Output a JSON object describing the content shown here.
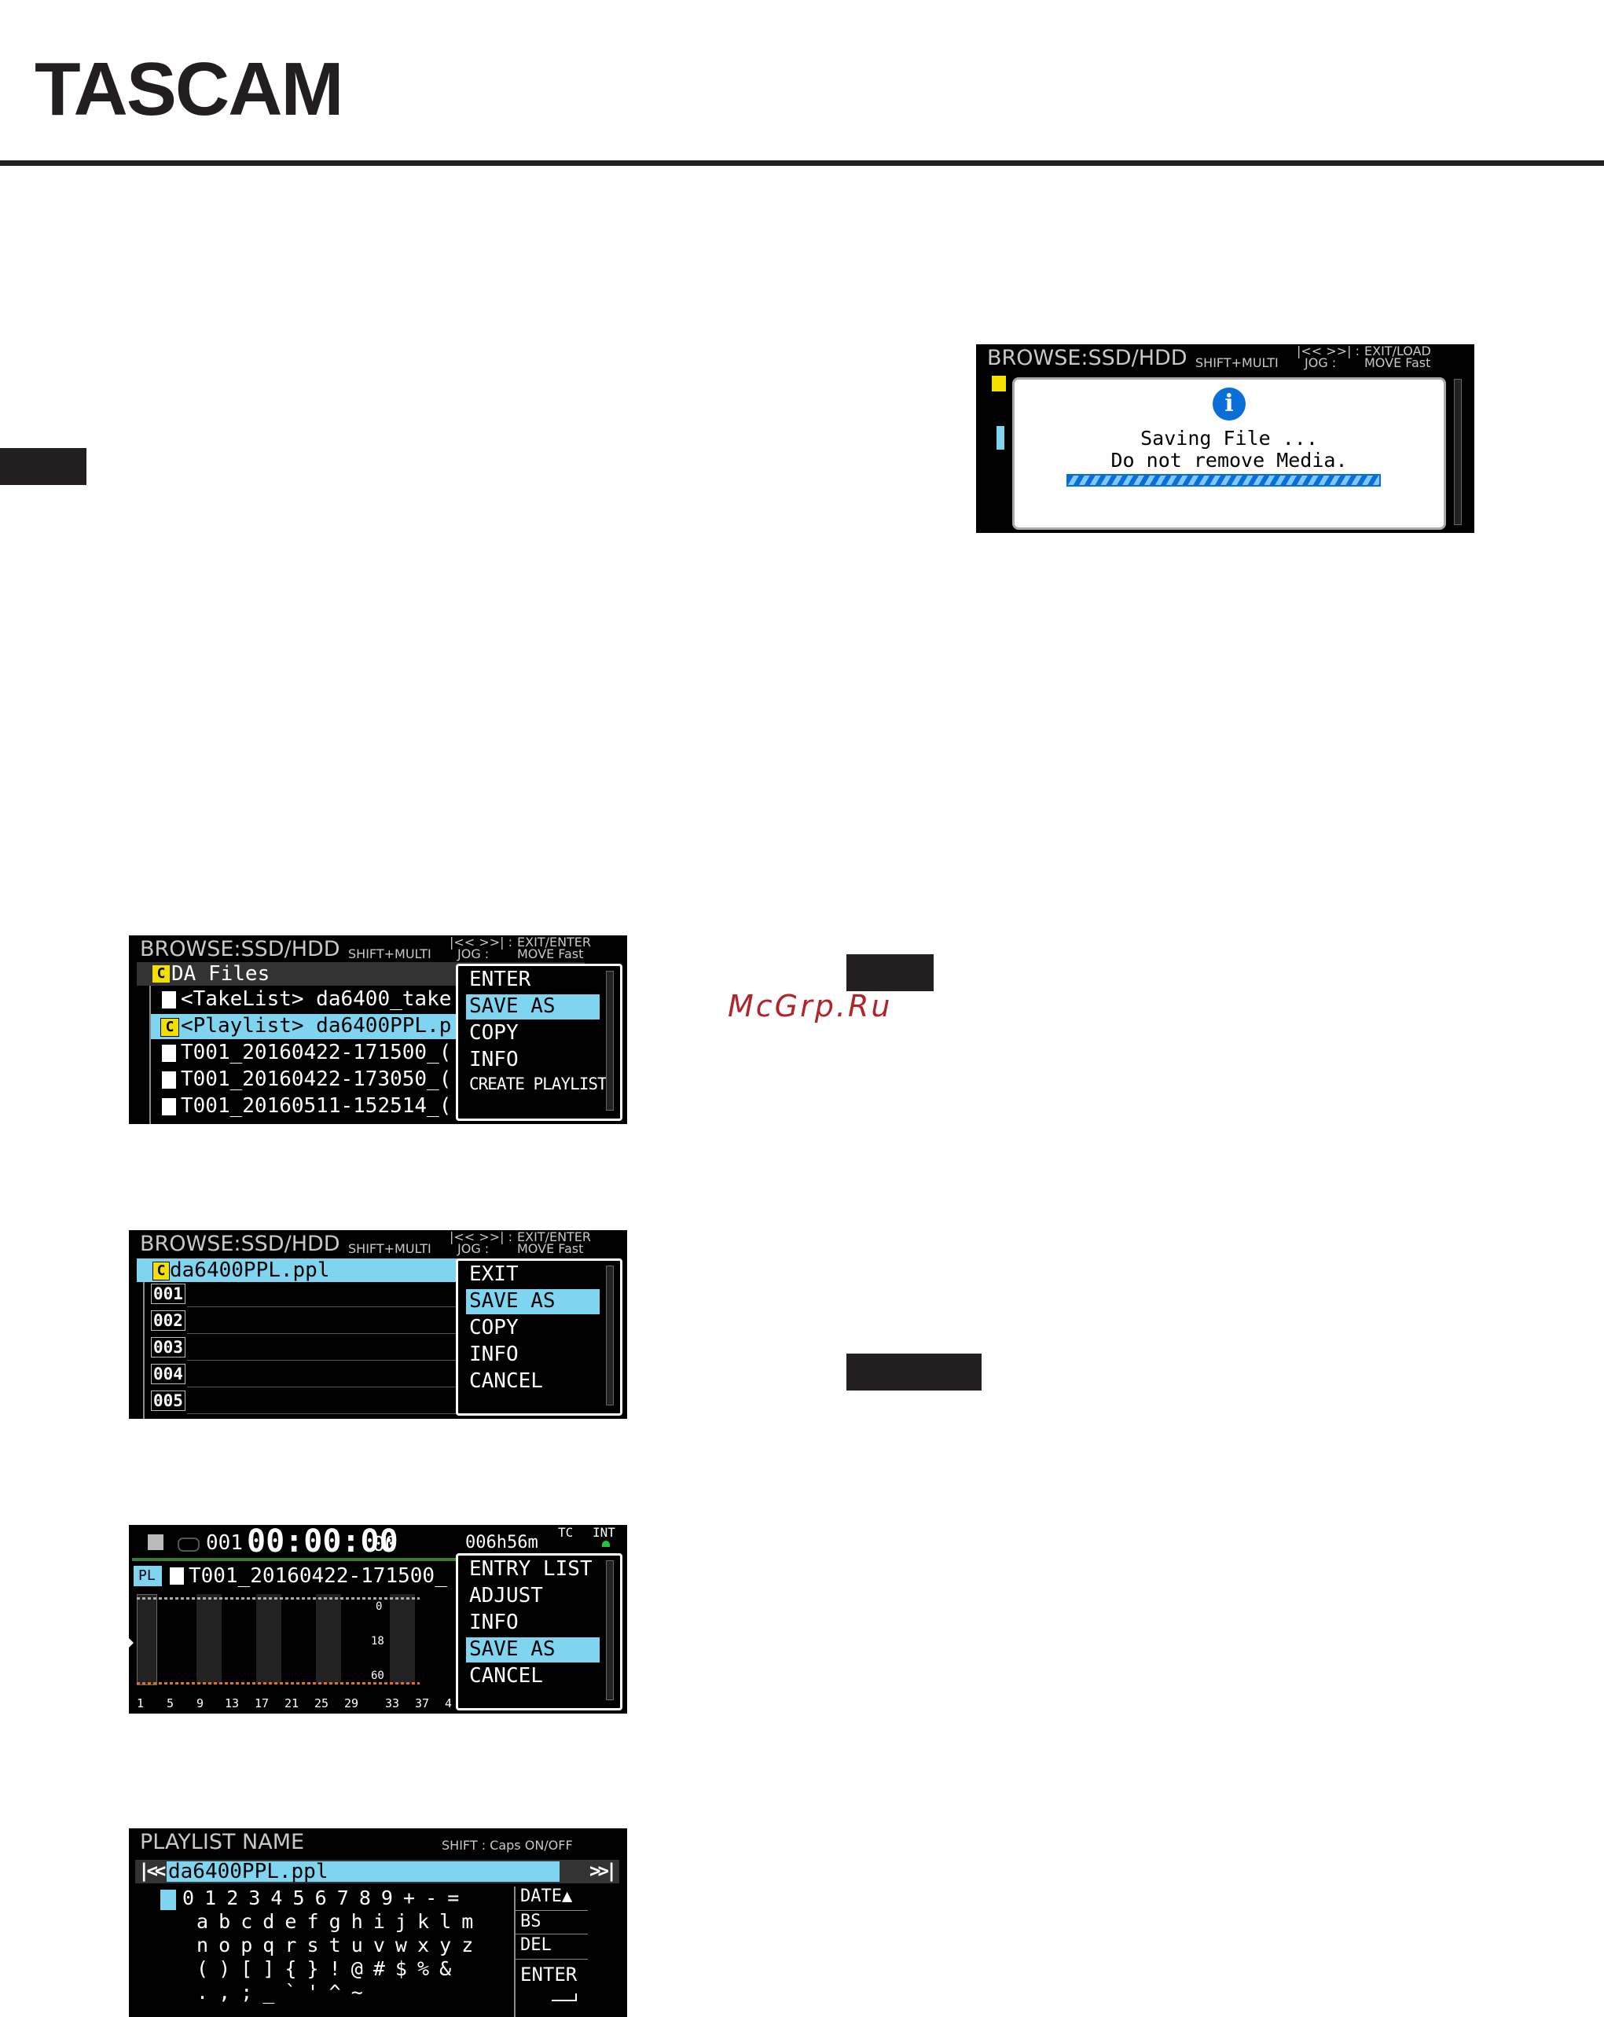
{
  "brand": {
    "logo": "TASCAM"
  },
  "watermark": "McGrp.Ru",
  "screen_saving": {
    "title": "BROWSE:SSD/HDD",
    "shift_multi": "SHIFT+MULTI",
    "skip_symbols": "|<<  >>|  :",
    "jog": "JOG  :",
    "exit_load": "EXIT/LOAD",
    "move_fast": "MOVE Fast",
    "info_icon": "i",
    "message_line1": "Saving File ...",
    "message_line2": "Do not remove Media."
  },
  "screen_browse": {
    "title": "BROWSE:SSD/HDD",
    "shift_multi": "SHIFT+MULTI",
    "skip_symbols": "|<<  >>|  :",
    "jog": "JOG  :",
    "exit_enter": "EXIT/ENTER",
    "move_fast": "MOVE Fast",
    "folder_badge": "C",
    "folder_name": "DA Files",
    "items": [
      "<TakeList> da6400_take",
      "<Playlist> da6400PPL.p",
      "T001_20160422-171500_(",
      "T001_20160422-173050_(",
      "T001_20160511-152514_("
    ],
    "menu": [
      "ENTER",
      "SAVE AS",
      "COPY",
      "INFO",
      "CREATE PLAYLIST"
    ]
  },
  "screen_playlist": {
    "title": "BROWSE:SSD/HDD",
    "shift_multi": "SHIFT+MULTI",
    "skip_symbols": "|<<  >>|  :",
    "jog": "JOG  :",
    "exit_enter": "EXIT/ENTER",
    "move_fast": "MOVE Fast",
    "badge": "C",
    "file": "da6400PPL.ppl",
    "entries": [
      "001",
      "002",
      "003",
      "004",
      "005"
    ],
    "menu": [
      "EXIT",
      "SAVE AS",
      "COPY",
      "INFO",
      "CANCEL"
    ]
  },
  "screen_home": {
    "stop_icon": "stop-icon",
    "entry": "001",
    "timecode": "00:00:00",
    "frames": "00",
    "remain": "006h56m",
    "tc": "TC",
    "int": "INT",
    "pl_badge": "PL",
    "track": "T001_20160422-171500_",
    "scale": [
      "0",
      "18",
      "60"
    ],
    "channels": [
      "1",
      "5",
      "9",
      "13",
      "17",
      "21",
      "25",
      "29",
      "33",
      "37",
      "4"
    ],
    "menu": [
      "ENTRY LIST",
      "ADJUST",
      "INFO",
      "SAVE AS",
      "CANCEL"
    ]
  },
  "screen_name": {
    "title": "PLAYLIST NAME",
    "hint": "SHIFT : Caps ON/OFF",
    "prev": "|<<",
    "next": ">>|",
    "name": "da6400PPL.ppl",
    "rows": [
      "0 1 2 3 4 5 6 7 8 9 + - =",
      "a b c d e f g h i j k l m",
      "n o p q r s t u v w x y z",
      "( ) [ ] { } ! @ # $ % &",
      ". , ; _ ` ' ^ ~"
    ],
    "side_keys": [
      "DATE▲",
      "BS",
      "DEL",
      "ENTER"
    ]
  }
}
